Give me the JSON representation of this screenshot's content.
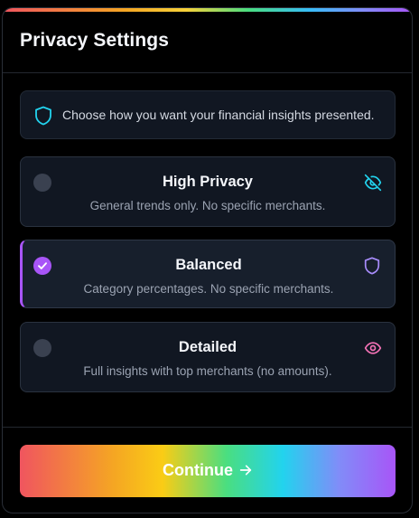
{
  "header": {
    "title": "Privacy Settings"
  },
  "info": {
    "icon": "shield-icon",
    "text": "Choose how you want your financial insights presented."
  },
  "options": [
    {
      "title": "High Privacy",
      "description": "General trends only. No specific merchants.",
      "icon": "eye-off-icon",
      "icon_color": "#22d3ee",
      "selected": false
    },
    {
      "title": "Balanced",
      "description": "Category percentages. No specific merchants.",
      "icon": "shield-icon",
      "icon_color": "#a78bfa",
      "selected": true
    },
    {
      "title": "Detailed",
      "description": "Full insights with top merchants (no amounts).",
      "icon": "eye-icon",
      "icon_color": "#f472b6",
      "selected": false
    }
  ],
  "footer": {
    "continue_label": "Continue",
    "continue_icon": "arrow-right-icon"
  },
  "colors": {
    "accent": "#a855f7",
    "background": "#000000",
    "card": "#111722"
  }
}
